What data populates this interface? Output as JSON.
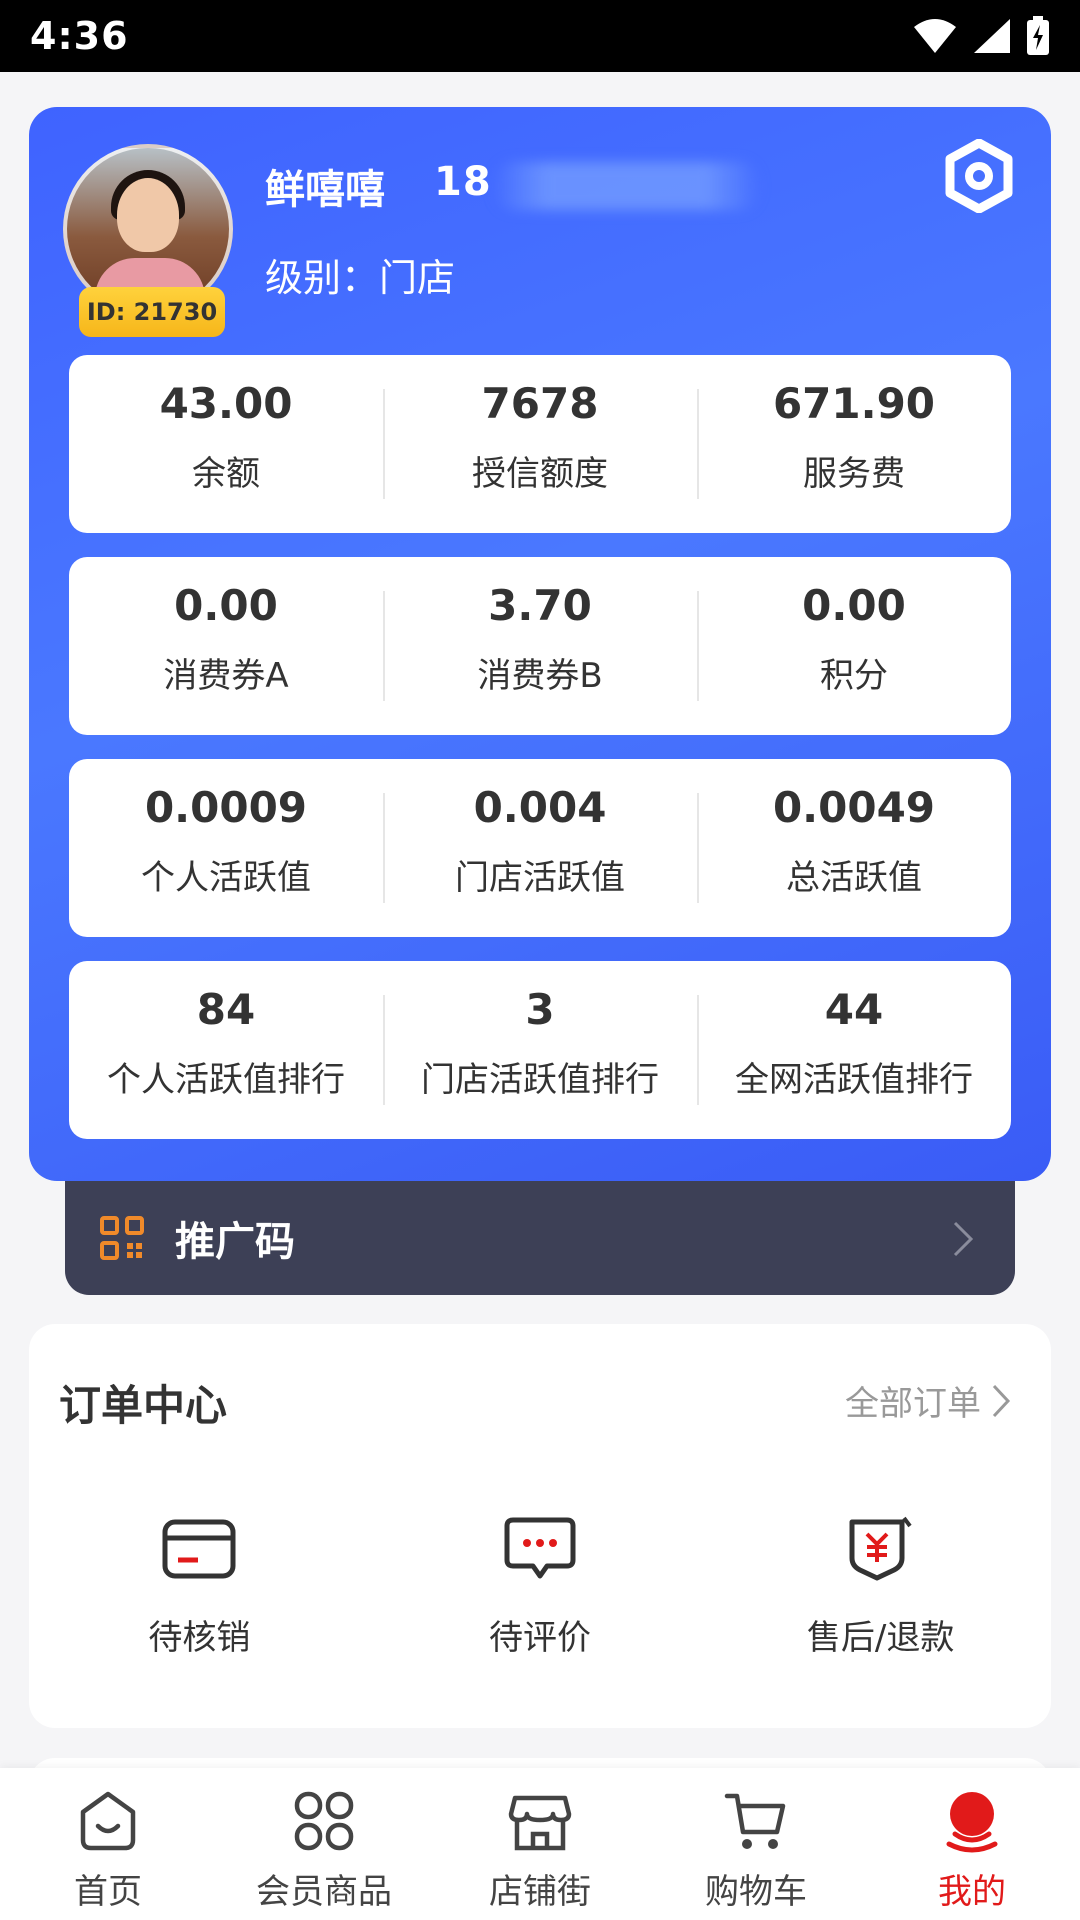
{
  "status_bar": {
    "time": "4:36"
  },
  "profile": {
    "name": "鲜嘻嘻",
    "phone_visible": "18",
    "level_label": "级别：门店",
    "id_badge": "ID: 21730"
  },
  "stats": [
    [
      {
        "value": "43.00",
        "label": "余额"
      },
      {
        "value": "7678",
        "label": "授信额度"
      },
      {
        "value": "671.90",
        "label": "服务费"
      }
    ],
    [
      {
        "value": "0.00",
        "label": "消费券A"
      },
      {
        "value": "3.70",
        "label": "消费券B"
      },
      {
        "value": "0.00",
        "label": "积分"
      }
    ],
    [
      {
        "value": "0.0009",
        "label": "个人活跃值"
      },
      {
        "value": "0.004",
        "label": "门店活跃值"
      },
      {
        "value": "0.0049",
        "label": "总活跃值"
      }
    ],
    [
      {
        "value": "84",
        "label": "个人活跃值排行"
      },
      {
        "value": "3",
        "label": "门店活跃值排行"
      },
      {
        "value": "44",
        "label": "全网活跃值排行"
      }
    ]
  ],
  "promo": {
    "label": "推广码",
    "icon": "qr-code-icon"
  },
  "orders": {
    "title": "订单中心",
    "all_label": "全部订单",
    "items": [
      {
        "label": "待核销",
        "icon": "card-icon"
      },
      {
        "label": "待评价",
        "icon": "comment-icon"
      },
      {
        "label": "售后/退款",
        "icon": "refund-icon"
      }
    ]
  },
  "nav": {
    "items": [
      {
        "label": "首页",
        "icon": "home-icon"
      },
      {
        "label": "会员商品",
        "icon": "grid-icon"
      },
      {
        "label": "店铺街",
        "icon": "store-icon"
      },
      {
        "label": "购物车",
        "icon": "cart-icon"
      },
      {
        "label": "我的",
        "icon": "profile-icon",
        "active": true
      }
    ]
  },
  "colors": {
    "primary_blue": "#4a78ff",
    "accent_red": "#e11a1a",
    "badge_gold": "#f6b61a",
    "promo_bg": "#3d4056"
  }
}
